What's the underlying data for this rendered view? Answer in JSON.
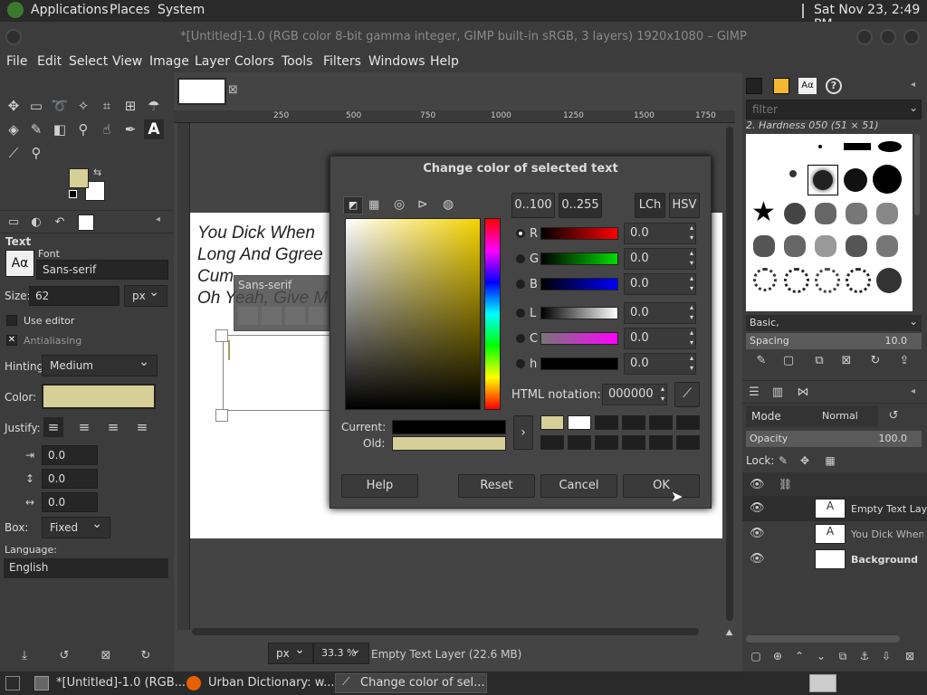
{
  "topbar": {
    "applications": "Applications",
    "places": "Places",
    "system": "System",
    "clock": "Sat Nov 23,  2:49 PM"
  },
  "window": {
    "title": "*[Untitled]-1.0 (RGB color 8-bit gamma integer, GIMP built-in sRGB, 3 layers) 1920x1080 – GIMP"
  },
  "menu": [
    "File",
    "Edit",
    "Select",
    "View",
    "Image",
    "Layer",
    "Colors",
    "Tools",
    "Filters",
    "Windows",
    "Help"
  ],
  "tool_options": {
    "section": "Text",
    "font_label": "Font",
    "font_value": "Sans-serif",
    "size_label": "Size:",
    "size_value": "62",
    "size_unit": "px",
    "use_editor": "Use editor",
    "antialiasing": "Antialiasing",
    "hinting_label": "Hinting:",
    "hinting_value": "Medium",
    "color_label": "Color:",
    "color": "#d6cf96",
    "justify_label": "Justify:",
    "indent": "0.0",
    "line_spacing": "0.0",
    "letter_spacing": "0.0",
    "box_label": "Box:",
    "box_value": "Fixed",
    "language_label": "Language:",
    "language_value": "English"
  },
  "canvas": {
    "text_lines": [
      "You Dick When",
      "Long And Ggree",
      "Cum",
      "Oh Yeah, Give M"
    ],
    "ruler_ticks": [
      "250",
      "500",
      "750",
      "1000",
      "1250",
      "1500",
      "1750"
    ],
    "text_toolbox_font": "Sans-serif",
    "status_unit": "px",
    "zoom": "33.3 %",
    "status_text": "Empty Text Layer (22.6 MB)"
  },
  "dialog": {
    "title": "Change color of selected text",
    "range_100": "0..100",
    "range_255": "0..255",
    "lch": "LCh",
    "hsv": "HSV",
    "channels": [
      {
        "label": "R",
        "value": "0.0"
      },
      {
        "label": "G",
        "value": "0.0"
      },
      {
        "label": "B",
        "value": "0.0"
      },
      {
        "label": "L",
        "value": "0.0"
      },
      {
        "label": "C",
        "value": "0.0"
      },
      {
        "label": "h",
        "value": "0.0"
      }
    ],
    "html_label": "HTML notation:",
    "html_value": "000000",
    "current_label": "Current:",
    "old_label": "Old:",
    "current_color": "#000000",
    "old_color": "#d6cf96",
    "help": "Help",
    "reset": "Reset",
    "cancel": "Cancel",
    "ok": "OK"
  },
  "brushes": {
    "filter_placeholder": "filter",
    "current": "2. Hardness 050 (51 × 51)",
    "preset": "Basic,",
    "spacing_label": "Spacing",
    "spacing_value": "10.0"
  },
  "layers": {
    "mode_label": "Mode",
    "mode_value": "Normal",
    "opacity_label": "Opacity",
    "opacity_value": "100.0",
    "lock_label": "Lock:",
    "items": [
      "Empty Text Laye",
      "You Dick When Y",
      "Background"
    ]
  },
  "taskbar": {
    "gimp_task": "*[Untitled]-1.0 (RGB...",
    "firefox_task": "Urban Dictionary: w...",
    "dialog_task": "Change color of sel..."
  }
}
